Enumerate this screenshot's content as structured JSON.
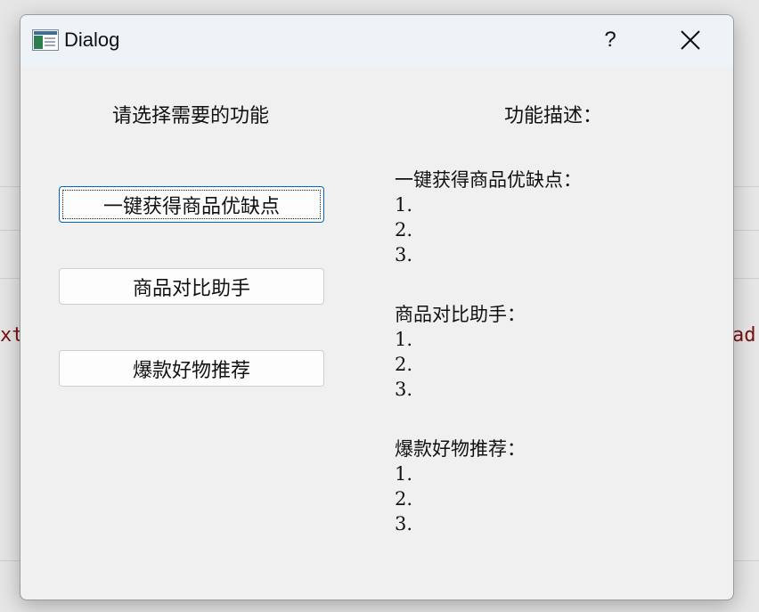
{
  "background": {
    "left_text": "xt",
    "right_text": "ad"
  },
  "window": {
    "title": "Dialog",
    "help_label": "?",
    "app_icon": "dialog-window-icon",
    "close_icon": "close-icon"
  },
  "left_panel": {
    "heading": "请选择需要的功能",
    "buttons": [
      {
        "label": "一键获得商品优缺点",
        "focused": true
      },
      {
        "label": "商品对比助手",
        "focused": false
      },
      {
        "label": "爆款好物推荐",
        "focused": false
      }
    ]
  },
  "right_panel": {
    "heading": "功能描述：",
    "sections": [
      {
        "title": "一键获得商品优缺点：",
        "items": [
          "1.",
          "2.",
          "3."
        ]
      },
      {
        "title": "商品对比助手：",
        "items": [
          "1.",
          "2.",
          "3."
        ]
      },
      {
        "title": "爆款好物推荐：",
        "items": [
          "1.",
          "2.",
          "3."
        ]
      }
    ]
  }
}
